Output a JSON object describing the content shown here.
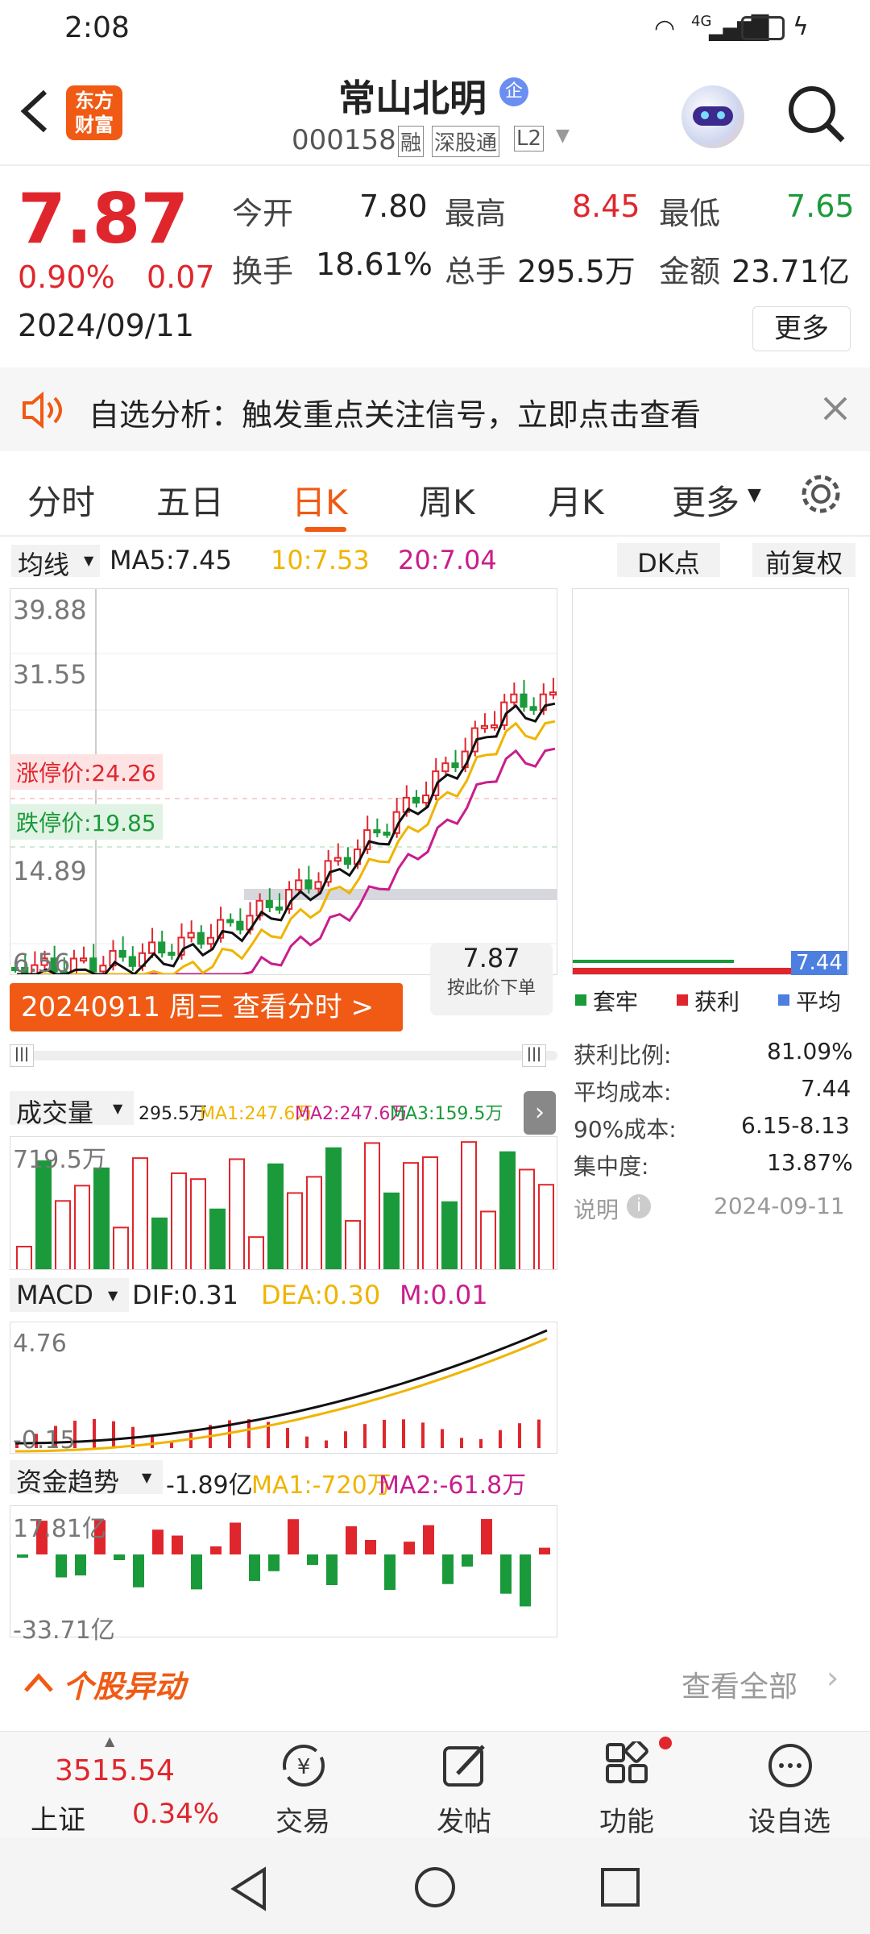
{
  "status": {
    "time": "2:08",
    "signal": "4G",
    "battery": "5"
  },
  "header": {
    "logo": "东方\n财富",
    "name": "常山北明",
    "badge": "企",
    "code": "000158",
    "tags": [
      "融",
      "深股通",
      "L2"
    ]
  },
  "quote": {
    "price": "7.87",
    "pct": "0.90%",
    "chg": "0.07",
    "date": "2024/09/11",
    "stats": [
      [
        "今开",
        "7.80",
        "n"
      ],
      [
        "最高",
        "8.45",
        "r"
      ],
      [
        "最低",
        "7.65",
        "g"
      ],
      [
        "换手",
        "18.61%",
        "n"
      ],
      [
        "总手",
        "295.5万",
        "n"
      ],
      [
        "金额",
        "23.71亿",
        "n"
      ]
    ],
    "more": "更多"
  },
  "alert": {
    "text": "自选分析：触发重点关注信号，立即点击查看"
  },
  "tabs": [
    "分时",
    "五日",
    "日K",
    "周K",
    "月K",
    "更多"
  ],
  "kline": {
    "ma_label": "均线",
    "ma5": "MA5:7.45",
    "ma10": "10:7.53",
    "ma20": "20:7.04",
    "dk": "DK点",
    "fq": "前复权",
    "yticks": [
      "39.88",
      "31.55",
      "14.89",
      "6.56"
    ],
    "limit_up": "涨停价:24.26",
    "limit_down": "跌停价:19.85",
    "price_tag": "7.87",
    "order": "按此价下单",
    "banner": "20240911 周三 查看分时 >"
  },
  "chips": {
    "legend": [
      "套牢",
      "获利",
      "平均"
    ],
    "avg": "7.44",
    "rows": [
      [
        "获利比例:",
        "81.09%"
      ],
      [
        "平均成本:",
        "7.44"
      ],
      [
        "90%成本:",
        "6.15-8.13"
      ],
      [
        "集中度:",
        "13.87%"
      ]
    ],
    "note": "说明",
    "note_date": "2024-09-11"
  },
  "volume": {
    "label": "成交量",
    "v": "295.5万",
    "ma1": "MA1:247.6万",
    "ma2": "MA2:247.6万",
    "ma3": "MA3:159.5万",
    "top": "719.5万"
  },
  "macd": {
    "label": "MACD",
    "dif": "DIF:0.31",
    "dea": "DEA:0.30",
    "m": "M:0.01",
    "top": "4.76",
    "bottom": "-0.15"
  },
  "fund": {
    "label": "资金趋势",
    "v": "-1.89亿",
    "ma1": "MA1:-720万",
    "ma2": "MA2:-61.8万",
    "top": "17.81亿",
    "bottom": "-33.71亿"
  },
  "movers": {
    "title": "个股异动",
    "link": "查看全部"
  },
  "bottom": {
    "index_val": "3515.54",
    "index_name": "上证",
    "index_pct": "0.34%",
    "items": [
      "交易",
      "发帖",
      "功能",
      "设自选"
    ]
  },
  "colors": {
    "up": "#e0262d",
    "down": "#1a9a3a",
    "accent": "#f05a14",
    "ma5": "#111111",
    "ma10": "#f0b400",
    "ma20": "#c81e8c"
  }
}
